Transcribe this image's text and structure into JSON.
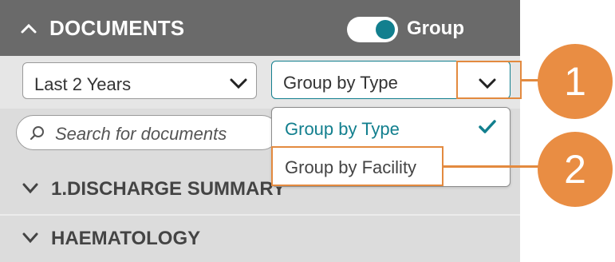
{
  "header": {
    "title": "DOCUMENTS",
    "toggle_label": "Group",
    "toggle_on": true
  },
  "filters": {
    "date_range": {
      "value": "Last 2 Years"
    },
    "grouping": {
      "value": "Group by Type"
    }
  },
  "search": {
    "placeholder": "Search for documents"
  },
  "dropdown": {
    "options": [
      {
        "label": "Group by Type",
        "selected": true
      },
      {
        "label": "Group by Facility",
        "selected": false
      }
    ]
  },
  "sections": [
    {
      "label": "1.DISCHARGE SUMMARY"
    },
    {
      "label": "HAEMATOLOGY"
    }
  ],
  "callouts": [
    {
      "label": "1"
    },
    {
      "label": "2"
    }
  ],
  "colors": {
    "header_bg": "#6a6a6a",
    "accent_teal": "#127f8e",
    "callout_orange": "#e38a3f"
  }
}
